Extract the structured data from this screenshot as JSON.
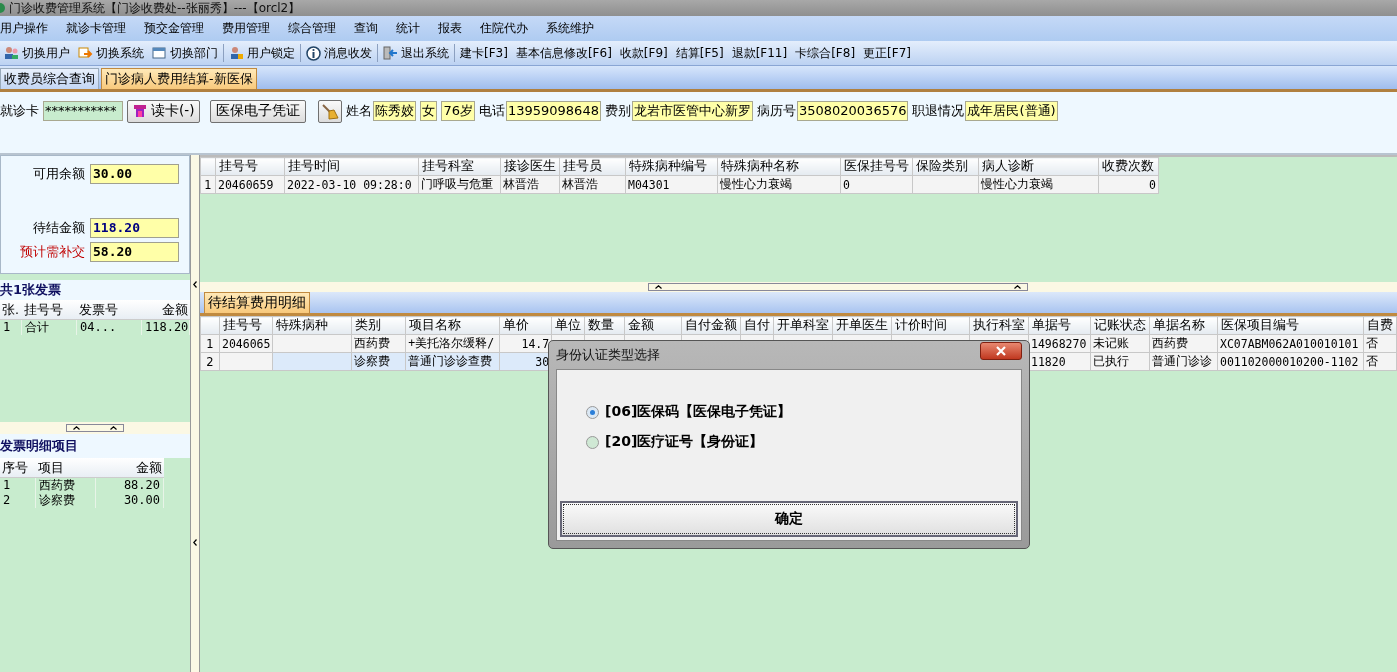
{
  "window": {
    "title": "门诊收费管理系统【门诊收费处--张丽秀】---【orcl2】"
  },
  "menu": [
    "用户操作",
    "就诊卡管理",
    "预交金管理",
    "费用管理",
    "综合管理",
    "查询",
    "统计",
    "报表",
    "住院代办",
    "系统维护"
  ],
  "toolbar": [
    {
      "label": "切换用户",
      "kind": "icon"
    },
    {
      "label": "切换系统",
      "kind": "icon"
    },
    {
      "label": "切换部门",
      "kind": "icon"
    },
    {
      "label": "用户锁定",
      "kind": "icon"
    },
    {
      "label": "消息收发",
      "kind": "icon"
    },
    {
      "label": "退出系统",
      "kind": "icon"
    },
    {
      "label": "建卡[F3]",
      "kind": "text"
    },
    {
      "label": "基本信息修改[F6]",
      "kind": "text"
    },
    {
      "label": "收款[F9]",
      "kind": "text"
    },
    {
      "label": "结算[F5]",
      "kind": "text"
    },
    {
      "label": "退款[F11]",
      "kind": "text"
    },
    {
      "label": "卡综合[F8]",
      "kind": "text"
    },
    {
      "label": "更正[F7]",
      "kind": "text"
    }
  ],
  "tabs": [
    {
      "label": "收费员综合查询",
      "selected": false
    },
    {
      "label": "门诊病人费用结算-新医保",
      "selected": true
    }
  ],
  "patient": {
    "card_label": "就诊卡",
    "card_value": "***********",
    "read_button": "读卡(-)",
    "voucher_button": "医保电子凭证",
    "fields": [
      {
        "label": "姓名",
        "value": "陈秀姣"
      },
      {
        "value": "女"
      },
      {
        "value": "76岁"
      },
      {
        "label": "电话",
        "value": "13959098648"
      },
      {
        "label": "费别",
        "value": "龙岩市医管中心新罗"
      },
      {
        "label": "病历号",
        "value": "3508020036576"
      },
      {
        "label": "职退情况",
        "value": "成年居民(普通)"
      }
    ]
  },
  "balances": [
    {
      "label": "可用余额",
      "value": "30.00",
      "kind": "plain"
    },
    {
      "label": "待结金额",
      "value": "118.20",
      "kind": "pending"
    },
    {
      "label": "预计需补交",
      "value": "58.20",
      "kind": "due"
    }
  ],
  "invoices": {
    "title": "共1张发票",
    "columns": [
      "张.",
      "挂号号",
      "发票号",
      "金额"
    ],
    "rows": [
      [
        "1",
        "合计",
        "04...",
        "118.20"
      ]
    ]
  },
  "invoice_items": {
    "title": "发票明细项目",
    "columns": [
      "序号",
      "项目",
      "金额"
    ],
    "rows": [
      [
        "1",
        "西药费",
        "88.20"
      ],
      [
        "2",
        "诊察费",
        "30.00"
      ]
    ]
  },
  "registrations": {
    "columns": [
      "挂号号",
      "挂号时间",
      "挂号科室",
      "接诊医生",
      "挂号员",
      "特殊病种编号",
      "特殊病种名称",
      "医保挂号号",
      "保险类别",
      "病人诊断",
      "收费次数"
    ],
    "rows": [
      {
        "index": "1",
        "cells": [
          "20460659",
          "2022-03-10 09:28:0",
          "门呼吸与危重",
          "林晋浩",
          "林晋浩",
          "M04301",
          "慢性心力衰竭",
          "0",
          "",
          "慢性心力衰竭",
          "0"
        ]
      }
    ]
  },
  "detail_tab": {
    "label": "待结算费用明细",
    "selected": true
  },
  "details": {
    "columns": [
      "挂号号",
      "特殊病种",
      "类别",
      "项目名称",
      "单价",
      "单位",
      "数量",
      "金额",
      "自付金额",
      "自付",
      "开单科室",
      "开单医生",
      "计价时间",
      "执行科室",
      "单据号",
      "记账状态",
      "单据名称",
      "医保项目编号",
      "自费"
    ],
    "rows": [
      {
        "index": "1",
        "selected": false,
        "cells": [
          "2046065",
          "",
          "西药费",
          "+美托洛尔缓释/",
          "14.7",
          "",
          "",
          "",
          "",
          "",
          "",
          "",
          "",
          "",
          "14968270",
          "未记账",
          "西药费",
          "XC07ABM062A010010101",
          "否"
        ]
      },
      {
        "index": "2",
        "selected": true,
        "cells": [
          "",
          "",
          "诊察费",
          "普通门诊诊查费",
          "30",
          "",
          "",
          "",
          "",
          "",
          "",
          "",
          "",
          "",
          "11820",
          "已执行",
          "普通门诊诊",
          "001102000010200-1102",
          "否"
        ]
      }
    ]
  },
  "dialog": {
    "title": "身份认证类型选择",
    "options": [
      {
        "label": "[06]医保码【医保电子凭证】",
        "selected": true
      },
      {
        "label": "[20]医疗证号【身份证】",
        "selected": false
      }
    ],
    "button": "确定"
  }
}
